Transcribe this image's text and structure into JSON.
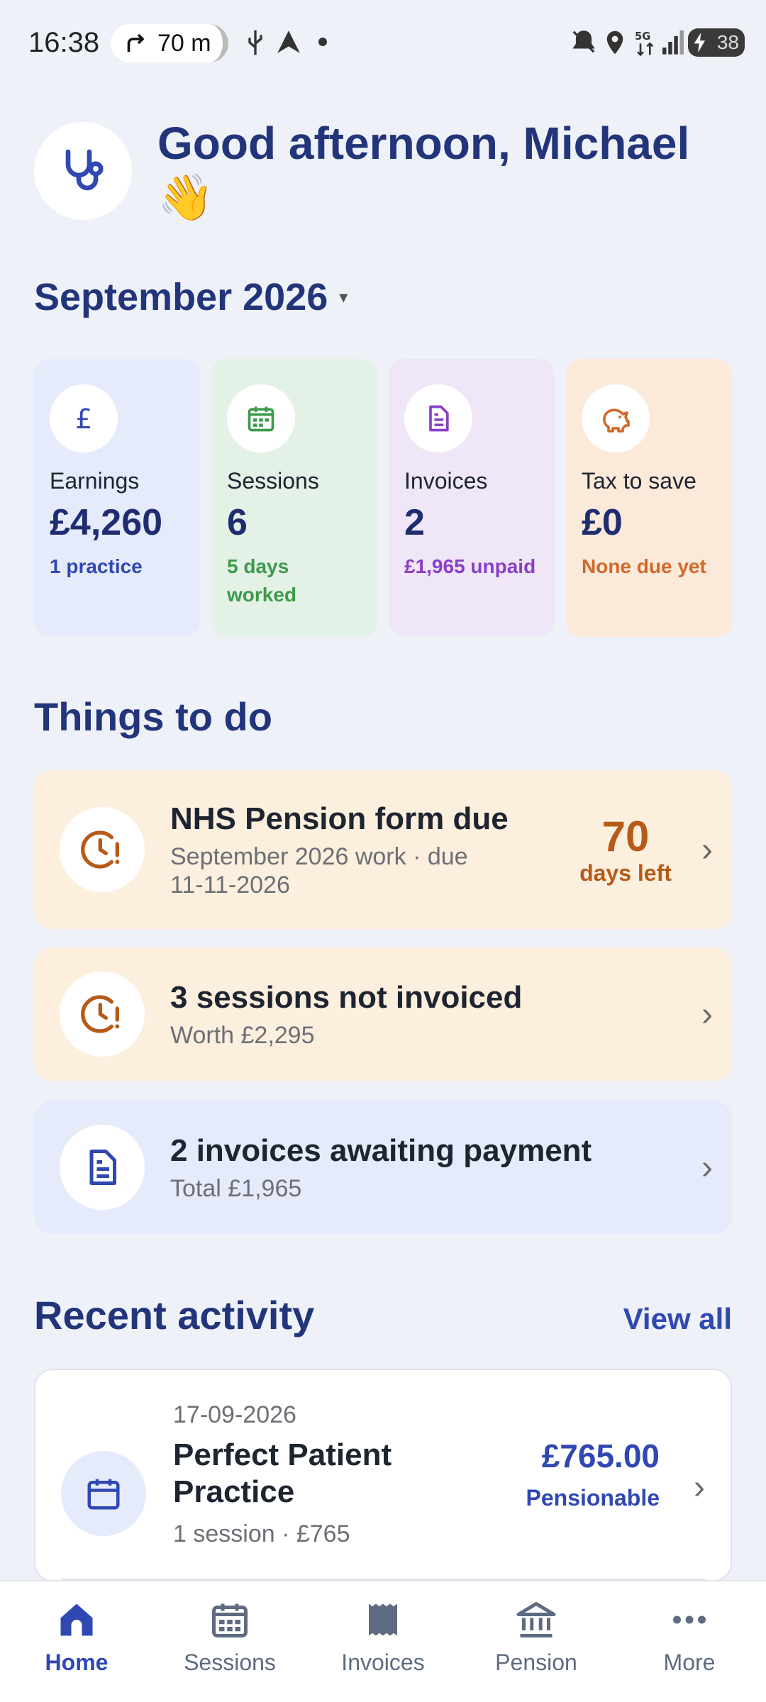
{
  "status_bar": {
    "time": "16:38",
    "nav_distance": "70 m",
    "battery": "38",
    "icons": [
      "turn-right-icon",
      "usb-icon",
      "navigation-icon",
      "dot-icon",
      "mute-icon",
      "location-icon",
      "5g-icon",
      "signal-icon",
      "battery-icon"
    ]
  },
  "header": {
    "greeting": "Good afternoon, Michael 👋",
    "logo_icon": "stethoscope-icon"
  },
  "period": {
    "label": "September 2026",
    "caret": "▾"
  },
  "stats": [
    {
      "label": "Earnings",
      "value": "£4,260",
      "sub": "1 practice",
      "icon": "pound-icon",
      "color": "#2f48b2"
    },
    {
      "label": "Sessions",
      "value": "6",
      "sub": "5 days worked",
      "icon": "calendar-icon",
      "color": "#3d9a4c"
    },
    {
      "label": "Invoices",
      "value": "2",
      "sub": "£1,965 unpaid",
      "icon": "document-icon",
      "color": "#8a3fc7"
    },
    {
      "label": "Tax to save",
      "value": "£0",
      "sub": "None due yet",
      "icon": "piggy-bank-icon",
      "color": "#d0692a"
    }
  ],
  "todo": {
    "title": "Things to do",
    "items": [
      {
        "title": "NHS Pension form due",
        "subtitle": "September 2026 work · due 11-11-2026",
        "days_num": "70",
        "days_label": "days left",
        "icon": "clock-alert-icon"
      },
      {
        "title": "3 sessions not invoiced",
        "subtitle": "Worth £2,295",
        "icon": "clock-alert-icon"
      },
      {
        "title": "2 invoices awaiting payment",
        "subtitle": "Total £1,965",
        "icon": "document-icon"
      }
    ],
    "chevron": "›"
  },
  "recent": {
    "title": "Recent activity",
    "view_all": "View all",
    "items": [
      {
        "date": "17-09-2026",
        "name": "Perfect Patient Practice",
        "detail": "1 session · £765",
        "amount": "£765.00",
        "tag": "Pensionable",
        "icon": "calendar-icon"
      }
    ]
  },
  "bottom_nav": [
    {
      "label": "Home",
      "icon": "home-icon",
      "active": true
    },
    {
      "label": "Sessions",
      "icon": "calendar-icon",
      "active": false
    },
    {
      "label": "Invoices",
      "icon": "receipt-icon",
      "active": false
    },
    {
      "label": "Pension",
      "icon": "bank-icon",
      "active": false
    },
    {
      "label": "More",
      "icon": "more-icon",
      "active": false
    }
  ]
}
